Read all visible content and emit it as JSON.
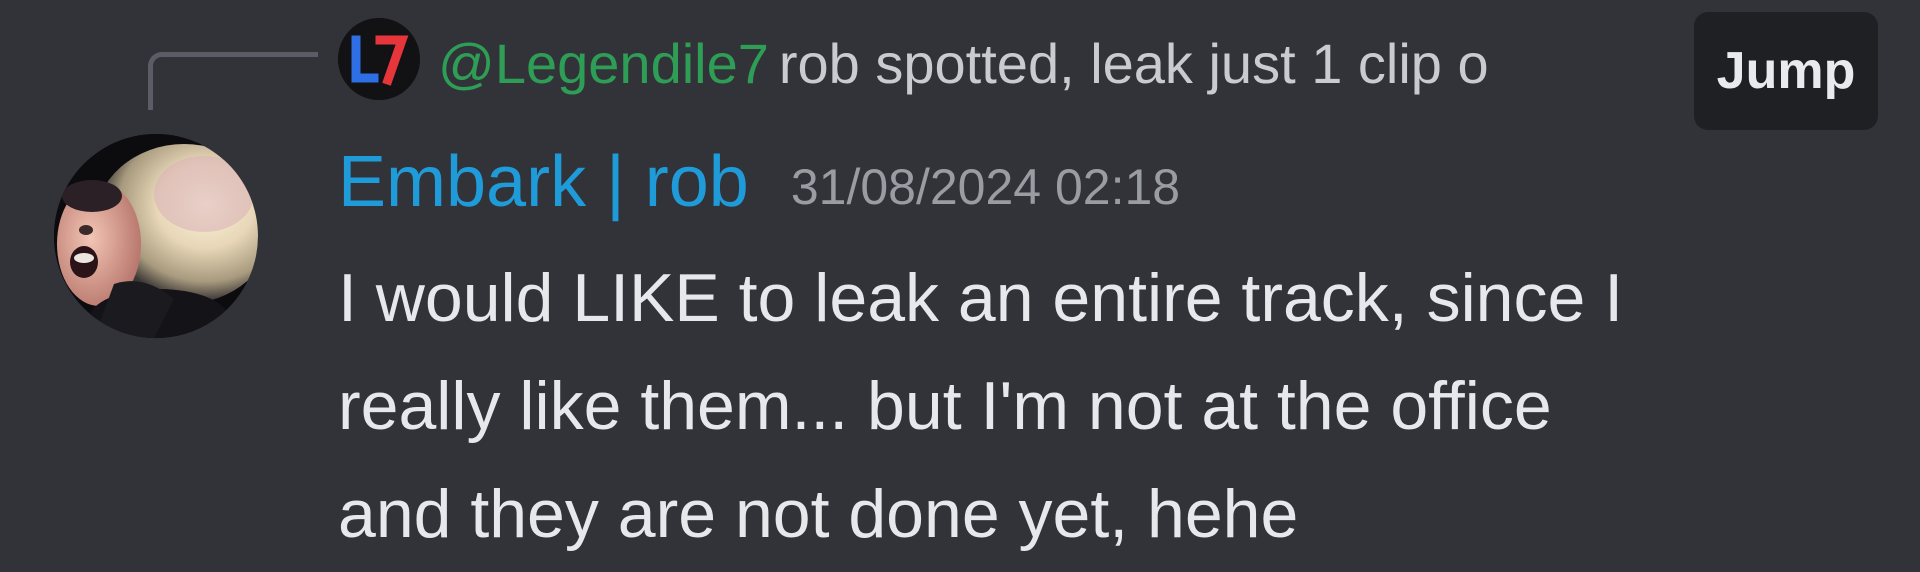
{
  "reply": {
    "avatar_icon": "l7-logo-icon",
    "mention": "@Legendile7",
    "preview_text": "rob spotted, leak just 1 clip o",
    "jump_label": "Jump"
  },
  "message": {
    "username": "Embark | rob",
    "timestamp": "31/08/2024 02:18",
    "lines": [
      "I would LIKE to leak an entire track, since I",
      "really like them... but I'm not at the office",
      "and they are not done yet, hehe"
    ]
  },
  "colors": {
    "background": "#323339",
    "username": "#1e9bd8",
    "mention": "#2e9d55",
    "jump_bg": "#1f2024"
  }
}
